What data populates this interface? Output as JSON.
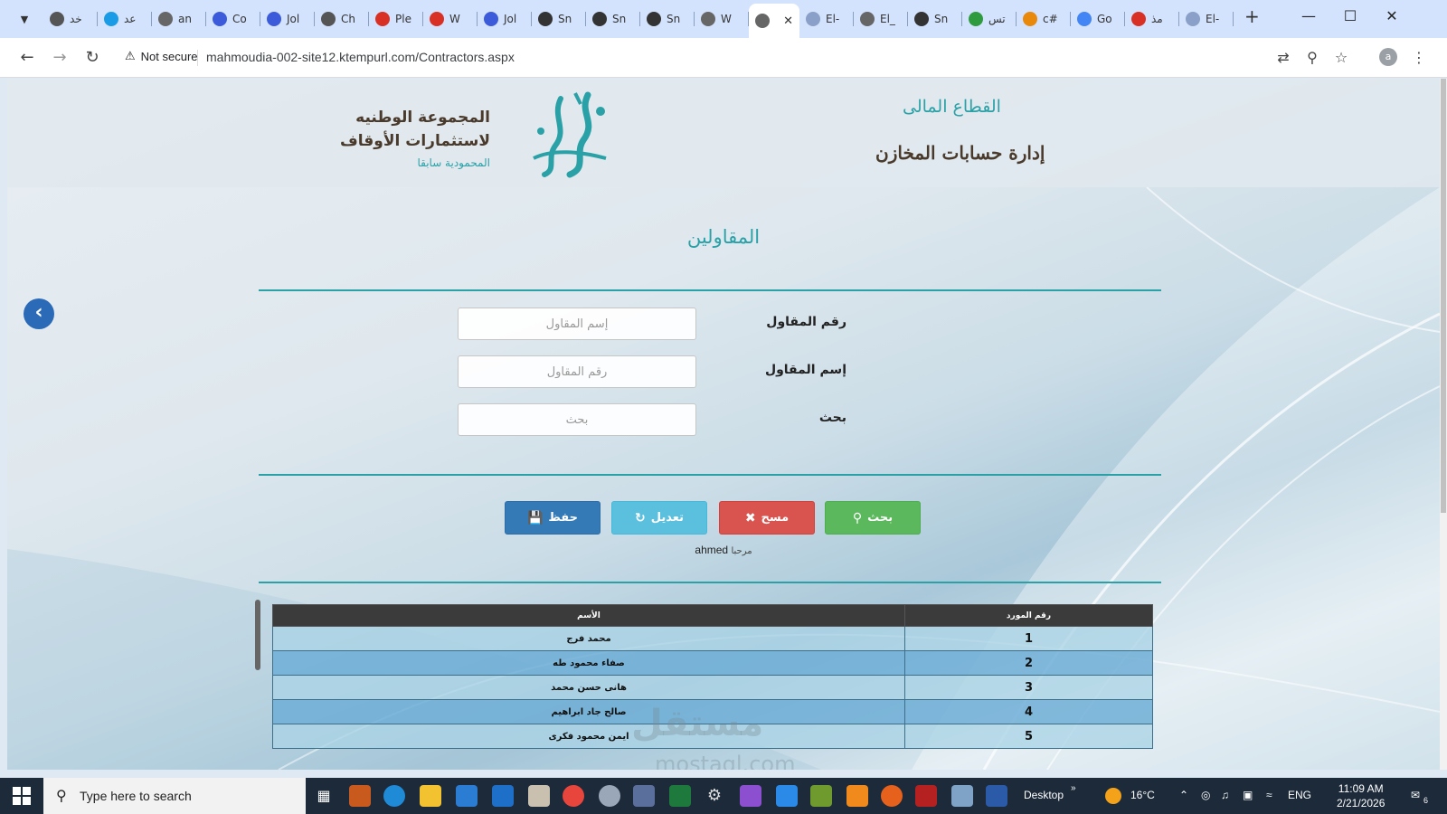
{
  "browser": {
    "tabs": [
      {
        "label": "خد",
        "icon": "chatgpt-icon",
        "color": "#555555"
      },
      {
        "label": "عد",
        "icon": "circle-blue-icon",
        "color": "#1a9be6"
      },
      {
        "label": "an",
        "icon": "globe-icon",
        "color": "#666666"
      },
      {
        "label": "Co",
        "icon": "jr-icon",
        "color": "#3b5bdb"
      },
      {
        "label": "Jol",
        "icon": "jr-icon",
        "color": "#3b5bdb"
      },
      {
        "label": "Ch",
        "icon": "chatgpt-icon",
        "color": "#555555"
      },
      {
        "label": "Ple",
        "icon": "gmail-icon",
        "color": "#d93025"
      },
      {
        "label": "W",
        "icon": "gmail-icon",
        "color": "#d93025"
      },
      {
        "label": "Jol",
        "icon": "jr-icon",
        "color": "#3b5bdb"
      },
      {
        "label": "Sn",
        "icon": "globe-icon",
        "color": "#333333"
      },
      {
        "label": "Sn",
        "icon": "globe-icon",
        "color": "#333333"
      },
      {
        "label": "Sn",
        "icon": "globe-icon",
        "color": "#333333"
      },
      {
        "label": "W",
        "icon": "globe-icon",
        "color": "#666666"
      },
      {
        "label": "",
        "icon": "globe-icon",
        "color": "#666666",
        "active": true
      },
      {
        "label": "El-",
        "icon": "bars-icon",
        "color": "#8aa0c8"
      },
      {
        "label": "El_",
        "icon": "globe-icon",
        "color": "#666666"
      },
      {
        "label": "Sn",
        "icon": "globe-icon",
        "color": "#333333"
      },
      {
        "label": "تس",
        "icon": "green-circle-icon",
        "color": "#2e9b3f"
      },
      {
        "label": "c#",
        "icon": "stack-icon",
        "color": "#e8890c"
      },
      {
        "label": "Go",
        "icon": "google-icon",
        "color": "#4285f4"
      },
      {
        "label": "مذ",
        "icon": "red-circle-icon",
        "color": "#d93025"
      },
      {
        "label": "El-",
        "icon": "bars-icon",
        "color": "#8aa0c8"
      }
    ],
    "not_secure": "Not secure",
    "url": "mahmoudia-002-site12.ktempurl.com/Contractors.aspx",
    "profile_initial": "a"
  },
  "header": {
    "org_line1": "المجموعة الوطنيه",
    "org_line2": "لاستثمارات الأوقاف",
    "org_line3": "المحمودية سابقا",
    "dept_line1": "القطاع المالى",
    "dept_line2": "إدارة حسابات المخازن"
  },
  "page": {
    "title": "المقاولين",
    "fields": [
      {
        "label": "رقم المقاول",
        "placeholder": "إسم المقاول",
        "value": ""
      },
      {
        "label": "إسم المقاول",
        "placeholder": "رقم المقاول",
        "value": ""
      },
      {
        "label": "بحث",
        "placeholder": "بحث",
        "value": ""
      }
    ],
    "buttons": {
      "save": "حفظ",
      "edit": "تعديل",
      "clear": "مسح",
      "search": "بحث"
    },
    "welcome_prefix": "مرحبا",
    "welcome_user": "ahmed",
    "table": {
      "headers": {
        "number": "رقم المورد",
        "name": "الأسم"
      },
      "rows": [
        {
          "number": "1",
          "name": "محمد فرج"
        },
        {
          "number": "2",
          "name": "صفاء محمود طه"
        },
        {
          "number": "3",
          "name": "هانى حسن محمد"
        },
        {
          "number": "4",
          "name": "صالح جاد ابراهيم"
        },
        {
          "number": "5",
          "name": "ايمن محمود فكرى"
        }
      ]
    },
    "watermark": "مستقل",
    "watermark_sub": "mostaql.com"
  },
  "taskbar": {
    "search_placeholder": "Type here to search",
    "desktop_label": "Desktop",
    "weather": "16°C",
    "language": "ENG",
    "time": "11:09 AM",
    "date": "2/21/2026",
    "notification_count": "6"
  }
}
